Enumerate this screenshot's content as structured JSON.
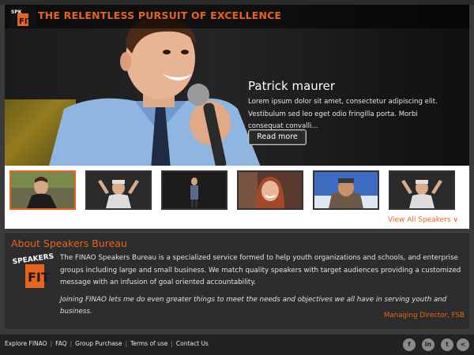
{
  "brand": {
    "tagline": "THE RELENTLESS PURSUIT OF EXCELLENCE",
    "logo_text": "SPEAKERS BUREAU FIT",
    "accent_color": "#e8641e"
  },
  "hero": {
    "name": "Patrick maurer",
    "description": "Lorem ipsum dolor sit amet, consectetur adipiscing elit. Vestibulum sed leo eget odio fringilla porta. Morbi consequat convalli...",
    "read_more": "Read more"
  },
  "thumbnails": [
    {
      "alt": "speaker-1"
    },
    {
      "alt": "speaker-2"
    },
    {
      "alt": "speaker-3"
    },
    {
      "alt": "speaker-4"
    },
    {
      "alt": "speaker-5"
    },
    {
      "alt": "speaker-6"
    }
  ],
  "view_all": "View All Speakers ∨",
  "about": {
    "title": "About Speakers Bureau",
    "body": "The FINAO Speakers Bureau is a specialized service formed to help youth organizations and schools, and enterprise groups including large and small business. We match quality speakers with target audiences providing a customized message with an infusion of goal oriented accountability.",
    "quote": "Joining FINAO lets me do even greater things to meet the needs and objectives we all have in serving youth and business.",
    "signature": "Managing Director, FSB"
  },
  "footer": {
    "links": [
      "Explore FINAO",
      "FAQ",
      "Group Purchase",
      "Terms of use",
      "Contact Us"
    ],
    "social": [
      {
        "icon": "facebook-icon",
        "glyph": "f"
      },
      {
        "icon": "linkedin-icon",
        "glyph": "in"
      },
      {
        "icon": "tumblr-icon",
        "glyph": "t"
      },
      {
        "icon": "share-icon",
        "glyph": "<"
      }
    ]
  }
}
